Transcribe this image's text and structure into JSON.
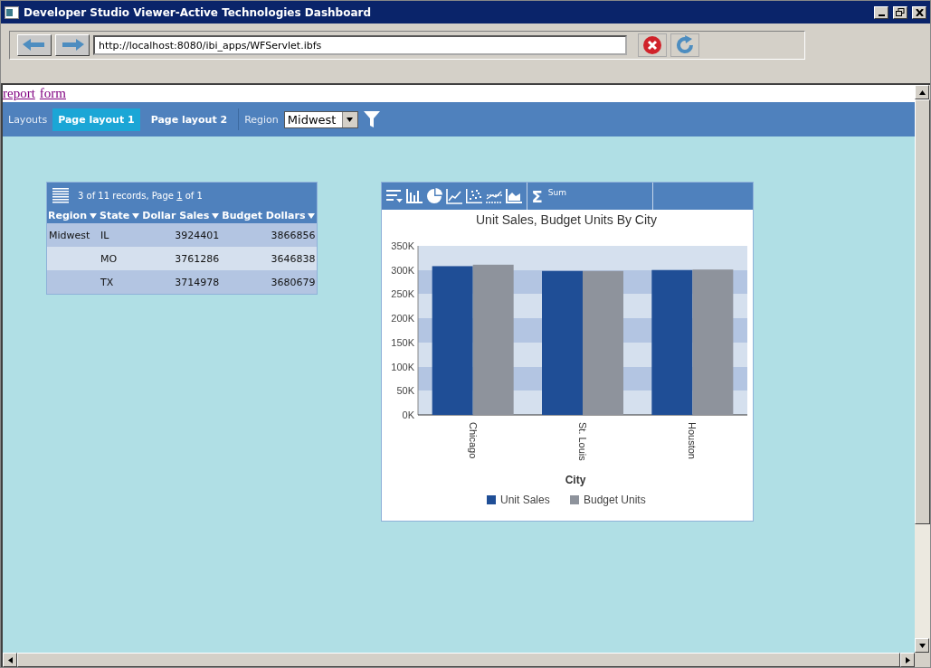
{
  "window": {
    "title": "Developer Studio Viewer-Active Technologies Dashboard"
  },
  "address_bar": {
    "value": "http://localhost:8080/ibi_apps/WFServlet.ibfs"
  },
  "links": [
    "report",
    "form"
  ],
  "toolbar": {
    "label": "Layouts",
    "tabs": [
      {
        "label": "Page layout 1",
        "selected": true
      },
      {
        "label": "Page layout 2",
        "selected": false
      }
    ],
    "filter_label": "Region",
    "filter_value": "Midwest"
  },
  "report": {
    "summary_prefix": "3 of 11 records, Page ",
    "page": "1",
    "summary_suffix": " of 1",
    "columns": [
      "Region",
      "State",
      "Dollar Sales",
      "Budget Dollars"
    ],
    "rows": [
      [
        "Midwest",
        "IL",
        "3924401",
        "3866856"
      ],
      [
        "",
        "MO",
        "3761286",
        "3646838"
      ],
      [
        "",
        "TX",
        "3714978",
        "3680679"
      ]
    ]
  },
  "chart_panel": {
    "sum_symbol": "Σ",
    "sum_label": "Sum",
    "chart_data": {
      "type": "bar",
      "title": "Unit Sales, Budget Units By City",
      "xlabel": "City",
      "categories": [
        "Chicago",
        "St. Louis",
        "Houston"
      ],
      "series": [
        {
          "name": "Unit Sales",
          "color": "#1f4e96",
          "values": [
            308000,
            298000,
            300000
          ]
        },
        {
          "name": "Budget Units",
          "color": "#8e939c",
          "values": [
            311000,
            298000,
            301000
          ]
        }
      ],
      "legend": true,
      "ylim": [
        0,
        350000
      ],
      "yticks": [
        {
          "value": 0,
          "label": "0K"
        },
        {
          "value": 50000,
          "label": "50K"
        },
        {
          "value": 100000,
          "label": "100K"
        },
        {
          "value": 150000,
          "label": "150K"
        },
        {
          "value": 200000,
          "label": "200K"
        },
        {
          "value": 250000,
          "label": "250K"
        },
        {
          "value": 300000,
          "label": "300K"
        },
        {
          "value": 350000,
          "label": "350K"
        }
      ]
    }
  }
}
